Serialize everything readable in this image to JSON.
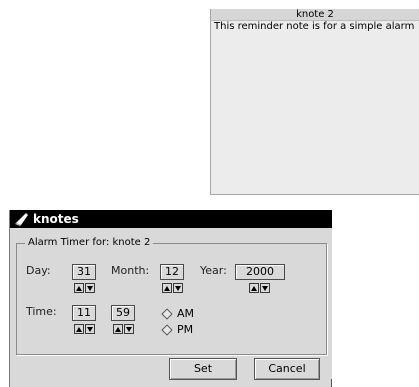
{
  "note": {
    "title": "knote 2",
    "body": "This reminder note is for a simple alarm"
  },
  "dialog": {
    "title": "knotes",
    "app_icon": "knotes-pen-icon",
    "group_title": "Alarm Timer for: knote 2",
    "day_label": "Day:",
    "day_value": "31",
    "month_label": "Month:",
    "month_value": "12",
    "year_label": "Year:",
    "year_value": "2000",
    "time_label": "Time:",
    "hour_value": "11",
    "minute_value": "59",
    "am_label": "AM",
    "pm_label": "PM",
    "selected_period": "PM",
    "set_label": "Set",
    "cancel_label": "Cancel"
  },
  "colors": {
    "dialog_bg": "#d9d9d9",
    "titlebar_bg": "#000000",
    "note_bg": "#ececec"
  }
}
